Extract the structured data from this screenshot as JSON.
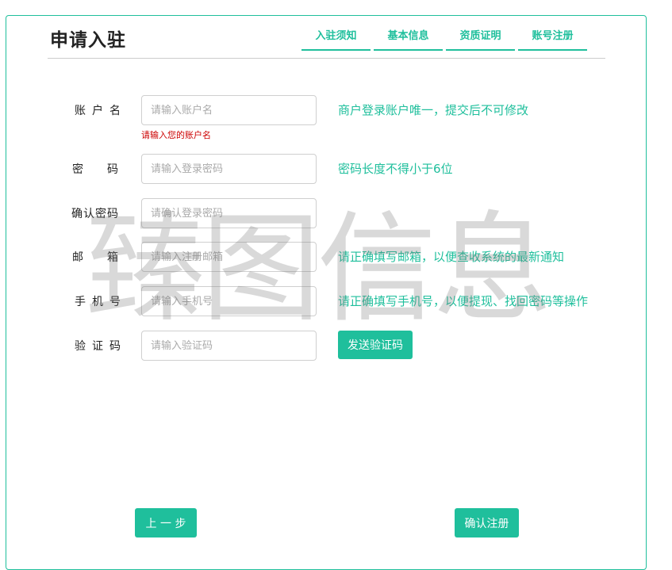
{
  "header": {
    "title": "申请入驻",
    "steps": [
      {
        "label": "入驻须知"
      },
      {
        "label": "基本信息"
      },
      {
        "label": "资质证明"
      },
      {
        "label": "账号注册"
      }
    ]
  },
  "form": {
    "account": {
      "label": "账户名",
      "placeholder": "请输入账户名",
      "error": "请输入您的账户名",
      "hint": "商户登录账户唯一，提交后不可修改"
    },
    "password": {
      "label": "密码",
      "placeholder": "请输入登录密码",
      "hint": "密码长度不得小于6位"
    },
    "confirm_password": {
      "label": "确认密码",
      "placeholder": "请确认登录密码"
    },
    "email": {
      "label": "邮箱",
      "placeholder": "请输入注册邮箱",
      "hint": "请正确填写邮箱，以便查收系统的最新通知"
    },
    "phone": {
      "label": "手机号",
      "placeholder": "请输入手机号",
      "hint": "请正确填写手机号，以便提现、找回密码等操作"
    },
    "code": {
      "label": "验证码",
      "placeholder": "请输入验证码",
      "send_button": "发送验证码"
    }
  },
  "footer": {
    "prev_label": "上 一 步",
    "submit_label": "确认注册"
  },
  "watermark": "臻图信息",
  "colors": {
    "accent": "#1fbf9c",
    "error": "#cc0000",
    "border": "#cfcfcf"
  }
}
